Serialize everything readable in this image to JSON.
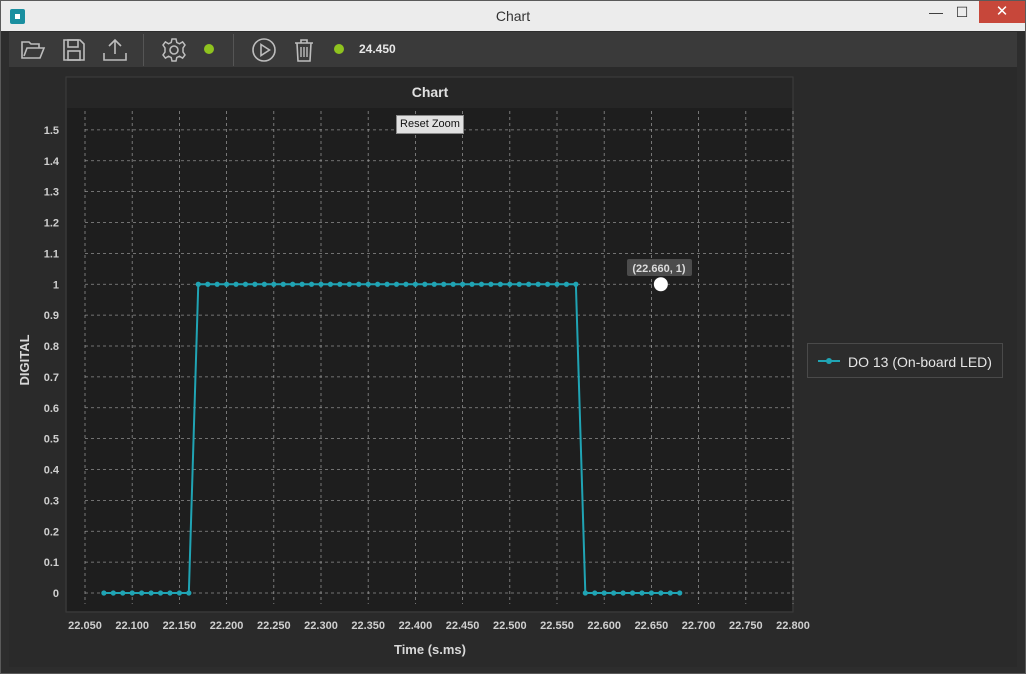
{
  "window": {
    "title": "Chart",
    "minimize_glyph": "—",
    "maximize_glyph": "☐",
    "close_glyph": "✕"
  },
  "toolbar": {
    "icons": [
      "open-folder-icon",
      "save-icon",
      "export-icon",
      "settings-icon",
      "play-icon",
      "trash-icon"
    ],
    "status_dot_color": "#8fc31f",
    "value": "24.450"
  },
  "chart": {
    "reset_zoom_label": "Reset Zoom",
    "tooltip": "(22.660, 1)",
    "legend_label": "DO 13 (On-board LED)"
  },
  "colors": {
    "series": "#20a4b4",
    "plot_bg": "#1e1e1e",
    "grid": "#bdbdbd"
  },
  "chart_data": {
    "type": "line",
    "title": "Chart",
    "xlabel": "Time (s.ms)",
    "ylabel": "DIGITAL",
    "xlim": [
      22.05,
      22.8
    ],
    "ylim": [
      0,
      1.6
    ],
    "xticks": [
      "22.050",
      "22.100",
      "22.150",
      "22.200",
      "22.250",
      "22.300",
      "22.350",
      "22.400",
      "22.450",
      "22.500",
      "22.550",
      "22.600",
      "22.650",
      "22.700",
      "22.750",
      "22.800"
    ],
    "yticks": [
      "0",
      "0.1",
      "0.2",
      "0.3",
      "0.4",
      "0.5",
      "0.6",
      "0.7",
      "0.8",
      "0.9",
      "1",
      "1.1",
      "1.2",
      "1.3",
      "1.4",
      "1.5"
    ],
    "grid": true,
    "legend_position": "right",
    "series": [
      {
        "name": "DO 13 (On-board LED)",
        "x_start": 22.07,
        "x_step": 0.01,
        "values": [
          0,
          0,
          0,
          0,
          0,
          0,
          0,
          0,
          0,
          0,
          1,
          1,
          1,
          1,
          1,
          1,
          1,
          1,
          1,
          1,
          1,
          1,
          1,
          1,
          1,
          1,
          1,
          1,
          1,
          1,
          1,
          1,
          1,
          1,
          1,
          1,
          1,
          1,
          1,
          1,
          1,
          1,
          1,
          1,
          1,
          1,
          1,
          1,
          1,
          1,
          1,
          0,
          0,
          0,
          0,
          0,
          0,
          0,
          0,
          0,
          0,
          0
        ]
      }
    ],
    "highlight": {
      "x": 22.66,
      "y": 1
    }
  }
}
